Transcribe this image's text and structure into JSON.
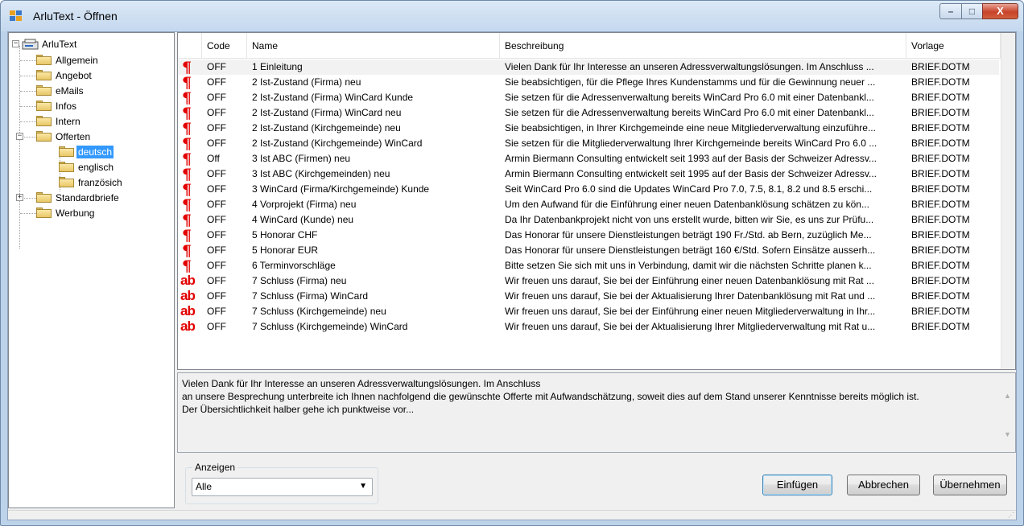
{
  "window": {
    "title": "ArluText - Öffnen",
    "minimize_glyph": "–",
    "maximize_glyph": "□",
    "close_glyph": "X"
  },
  "tree": {
    "root": "ArluText",
    "nodes": [
      "Allgemein",
      "Angebot",
      "eMails",
      "Infos",
      "Intern",
      "Offerten",
      "deutsch",
      "englisch",
      "französich",
      "Standardbriefe",
      "Werbung"
    ],
    "expander_minus": "−",
    "expander_plus": "+"
  },
  "grid": {
    "headers": {
      "code": "Code",
      "name": "Name",
      "desc": "Beschreibung",
      "vorlage": "Vorlage"
    },
    "rows": [
      {
        "icon": "paragraph-icon",
        "code": "OFF",
        "name": "1 Einleitung",
        "desc": "Vielen Dank für Ihr Interesse an unseren Adressverwaltungslösungen. Im Anschluss ...",
        "vorlage": "BRIEF.DOTM"
      },
      {
        "icon": "paragraph-icon",
        "code": "OFF",
        "name": "2 Ist-Zustand (Firma) neu",
        "desc": "Sie beabsichtigen, für die Pflege Ihres Kundenstamms und für die Gewinnung neuer ...",
        "vorlage": "BRIEF.DOTM"
      },
      {
        "icon": "paragraph-icon",
        "code": "OFF",
        "name": "2 Ist-Zustand (Firma) WinCard Kunde",
        "desc": "Sie setzen für die Adressenverwaltung bereits WinCard Pro 6.0 mit einer Datenbankl...",
        "vorlage": "BRIEF.DOTM"
      },
      {
        "icon": "paragraph-icon",
        "code": "OFF",
        "name": "2 Ist-Zustand (Firma) WinCard neu",
        "desc": "Sie setzen für die Adressenverwaltung bereits WinCard Pro 6.0 mit einer Datenbankl...",
        "vorlage": "BRIEF.DOTM"
      },
      {
        "icon": "paragraph-icon",
        "code": "OFF",
        "name": "2 Ist-Zustand (Kirchgemeinde) neu",
        "desc": "Sie beabsichtigen, in Ihrer Kirchgemeinde eine neue Mitgliederverwaltung einzuführe...",
        "vorlage": "BRIEF.DOTM"
      },
      {
        "icon": "paragraph-icon",
        "code": "OFF",
        "name": "2 Ist-Zustand (Kirchgemeinde) WinCard",
        "desc": "Sie setzen für die Mitgliederverwaltung Ihrer Kirchgemeinde bereits WinCard Pro 6.0 ...",
        "vorlage": "BRIEF.DOTM"
      },
      {
        "icon": "paragraph-icon",
        "code": "Off",
        "name": "3 Ist ABC (Firmen) neu",
        "desc": "Armin Biermann Consulting entwickelt seit 1993 auf der Basis der Schweizer Adressv...",
        "vorlage": "BRIEF.DOTM"
      },
      {
        "icon": "paragraph-icon",
        "code": "OFF",
        "name": "3 Ist ABC (Kirchgemeinden) neu",
        "desc": "Armin Biermann Consulting entwickelt seit 1995 auf der Basis der Schweizer Adressv...",
        "vorlage": "BRIEF.DOTM"
      },
      {
        "icon": "paragraph-icon",
        "code": "OFF",
        "name": "3 WinCard (Firma/Kirchgemeinde) Kunde",
        "desc": "Seit WinCard Pro 6.0 sind die Updates WinCard Pro 7.0, 7.5, 8.1, 8.2 und 8.5 erschi...",
        "vorlage": "BRIEF.DOTM"
      },
      {
        "icon": "paragraph-icon",
        "code": "OFF",
        "name": "4 Vorprojekt (Firma) neu",
        "desc": "Um den Aufwand für die Einführung einer neuen Datenbanklösung schätzen zu kön...",
        "vorlage": "BRIEF.DOTM"
      },
      {
        "icon": "paragraph-icon",
        "code": "OFF",
        "name": "4 WinCard (Kunde) neu",
        "desc": "Da Ihr Datenbankprojekt nicht von uns erstellt wurde, bitten wir Sie, es uns zur Prüfu...",
        "vorlage": "BRIEF.DOTM"
      },
      {
        "icon": "paragraph-icon",
        "code": "OFF",
        "name": "5 Honorar CHF",
        "desc": "Das Honorar für unsere Dienstleistungen beträgt 190 Fr./Std. ab Bern, zuzüglich Me...",
        "vorlage": "BRIEF.DOTM"
      },
      {
        "icon": "paragraph-icon",
        "code": "OFF",
        "name": "5 Honorar EUR",
        "desc": "Das Honorar für unsere Dienstleistungen beträgt 160 €/Std. Sofern Einsätze ausserh...",
        "vorlage": "BRIEF.DOTM"
      },
      {
        "icon": "paragraph-icon",
        "code": "OFF",
        "name": "6 Terminvorschläge",
        "desc": "Bitte setzen Sie sich mit uns in Verbindung, damit wir die nächsten Schritte planen k...",
        "vorlage": "BRIEF.DOTM"
      },
      {
        "icon": "text-ab-icon",
        "code": "OFF",
        "name": "7 Schluss (Firma) neu",
        "desc": "Wir freuen uns darauf, Sie bei der Einführung einer neuen Datenbanklösung mit Rat ...",
        "vorlage": "BRIEF.DOTM"
      },
      {
        "icon": "text-ab-icon",
        "code": "OFF",
        "name": "7 Schluss (Firma) WinCard",
        "desc": "Wir freuen uns darauf, Sie bei der Aktualisierung Ihrer Datenbanklösung mit Rat und ...",
        "vorlage": "BRIEF.DOTM"
      },
      {
        "icon": "text-ab-icon",
        "code": "OFF",
        "name": "7 Schluss (Kirchgemeinde) neu",
        "desc": "Wir freuen uns darauf, Sie bei der Einführung einer neuen Mitgliederverwaltung in Ihr...",
        "vorlage": "BRIEF.DOTM"
      },
      {
        "icon": "text-ab-icon",
        "code": "OFF",
        "name": "7 Schluss (Kirchgemeinde) WinCard",
        "desc": "Wir freuen uns darauf, Sie bei der Aktualisierung Ihrer Mitgliederverwaltung mit Rat u...",
        "vorlage": "BRIEF.DOTM"
      }
    ]
  },
  "preview": {
    "lines": [
      "Vielen Dank für Ihr Interesse an unseren Adressverwaltungslösungen. Im Anschluss",
      "an unsere Besprechung unterbreite ich Ihnen nachfolgend die gewünschte Offerte mit Aufwandschätzung, soweit dies auf dem Stand unserer Kenntnisse bereits möglich ist.",
      "Der Übersichtlichkeit halber gehe ich punktweise vor..."
    ],
    "scroll_up": "▲",
    "scroll_down": "▼"
  },
  "anzeigen": {
    "label": "Anzeigen",
    "value": "Alle",
    "arrow": "▼"
  },
  "buttons": {
    "einfuegen": "Einfügen",
    "abbrechen": "Abbrechen",
    "uebernehmen": "Übernehmen"
  },
  "statusbar": {
    "grip": "⋰"
  },
  "colors": {
    "icon_red": "#e30000",
    "selection_blue": "#3399ff"
  }
}
